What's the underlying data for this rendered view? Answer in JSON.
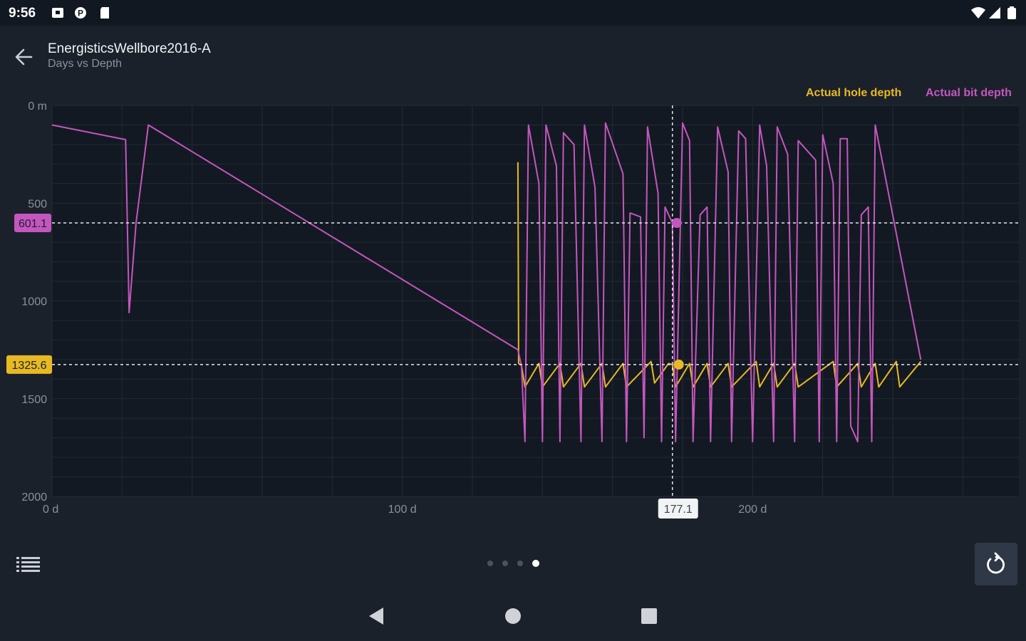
{
  "status_bar": {
    "time": "9:56",
    "left_icons": [
      "notification-square-icon",
      "p-circle-icon",
      "sd-card-icon"
    ],
    "right_icons": [
      "wifi-icon",
      "cell-signal-icon",
      "battery-icon"
    ]
  },
  "app_bar": {
    "title": "EnergisticsWellbore2016-A",
    "subtitle": "Days vs Depth",
    "back_icon": "arrow-left-icon"
  },
  "legend": [
    {
      "name": "Actual hole depth",
      "color": "#e8b923"
    },
    {
      "name": "Actual bit depth",
      "color": "#c456bf"
    }
  ],
  "chart_data": {
    "type": "line",
    "xlabel": "",
    "ylabel": "",
    "x_unit": "d",
    "y_unit": "m",
    "xlim": [
      0,
      276
    ],
    "ylim": [
      2000,
      0
    ],
    "y_reversed": true,
    "x_ticks": [
      "0 d",
      "100 d",
      "200 d"
    ],
    "x_tick_values": [
      0,
      100,
      200
    ],
    "y_ticks": [
      "0 m",
      "500",
      "1000",
      "1500",
      "2000"
    ],
    "y_tick_values": [
      0,
      500,
      1000,
      1500,
      2000
    ],
    "grid": true,
    "legend_position": "top-right",
    "cursor": {
      "x": 177.1,
      "x_label": "177.1",
      "bit_depth_label": "601.1",
      "bit_depth": 601.1,
      "hole_depth_label": "1325.6",
      "hole_depth": 1325.6
    },
    "series": [
      {
        "name": "Actual hole depth",
        "color": "#e8b923",
        "points": [
          [
            133.0,
            290
          ],
          [
            133.2,
            1320
          ],
          [
            134,
            1330
          ],
          [
            135,
            1440
          ],
          [
            139,
            1320
          ],
          [
            140,
            1440
          ],
          [
            145,
            1320
          ],
          [
            146,
            1440
          ],
          [
            151,
            1320
          ],
          [
            152,
            1440
          ],
          [
            157,
            1320
          ],
          [
            158,
            1440
          ],
          [
            163,
            1320
          ],
          [
            164,
            1440
          ],
          [
            171,
            1310
          ],
          [
            172,
            1420
          ],
          [
            176,
            1320
          ],
          [
            177.1,
            1325.6
          ],
          [
            178,
            1440
          ],
          [
            182,
            1320
          ],
          [
            183,
            1440
          ],
          [
            187,
            1320
          ],
          [
            188,
            1440
          ],
          [
            193,
            1320
          ],
          [
            194,
            1440
          ],
          [
            201,
            1310
          ],
          [
            202,
            1440
          ],
          [
            206,
            1320
          ],
          [
            207,
            1440
          ],
          [
            212,
            1320
          ],
          [
            213,
            1440
          ],
          [
            223,
            1310
          ],
          [
            224,
            1440
          ],
          [
            230,
            1320
          ],
          [
            231,
            1440
          ],
          [
            235,
            1320
          ],
          [
            236,
            1440
          ],
          [
            241,
            1310
          ],
          [
            242,
            1440
          ],
          [
            248,
            1310
          ]
        ]
      },
      {
        "name": "Actual bit depth",
        "color": "#c456bf",
        "points": [
          [
            0,
            100
          ],
          [
            21,
            175
          ],
          [
            21.5,
            600
          ],
          [
            22,
            1060
          ],
          [
            24,
            600
          ],
          [
            27.5,
            100
          ],
          [
            133,
            1250
          ],
          [
            134,
            1330
          ],
          [
            135,
            1720
          ],
          [
            136,
            100
          ],
          [
            139,
            400
          ],
          [
            140,
            1720
          ],
          [
            141,
            100
          ],
          [
            144,
            310
          ],
          [
            145,
            1720
          ],
          [
            146,
            140
          ],
          [
            149,
            200
          ],
          [
            151,
            1720
          ],
          [
            152,
            100
          ],
          [
            155,
            420
          ],
          [
            157,
            1720
          ],
          [
            158,
            90
          ],
          [
            163,
            350
          ],
          [
            164,
            1720
          ],
          [
            165,
            550
          ],
          [
            168,
            570
          ],
          [
            169,
            1700
          ],
          [
            170,
            110
          ],
          [
            173,
            450
          ],
          [
            174,
            1720
          ],
          [
            175,
            520
          ],
          [
            177.1,
            601.1
          ],
          [
            178,
            1720
          ],
          [
            180,
            90
          ],
          [
            182,
            180
          ],
          [
            183,
            1720
          ],
          [
            185,
            560
          ],
          [
            187,
            520
          ],
          [
            188,
            1720
          ],
          [
            190,
            110
          ],
          [
            193,
            340
          ],
          [
            194,
            1720
          ],
          [
            196,
            130
          ],
          [
            198,
            170
          ],
          [
            200,
            1720
          ],
          [
            202,
            100
          ],
          [
            204,
            310
          ],
          [
            206,
            1720
          ],
          [
            207,
            110
          ],
          [
            210,
            250
          ],
          [
            212,
            1720
          ],
          [
            213,
            180
          ],
          [
            218,
            280
          ],
          [
            219,
            1720
          ],
          [
            220,
            150
          ],
          [
            223,
            400
          ],
          [
            224,
            1720
          ],
          [
            225,
            170
          ],
          [
            227,
            170
          ],
          [
            228,
            1640
          ],
          [
            230,
            1720
          ],
          [
            231,
            560
          ],
          [
            233,
            520
          ],
          [
            234,
            1720
          ],
          [
            235,
            100
          ],
          [
            248,
            1300
          ]
        ]
      }
    ]
  },
  "bottom_bar": {
    "list_icon": "list-icon",
    "page_count": 4,
    "active_page": 3,
    "reset_icon": "reset-zoom-icon"
  },
  "nav_bar": {
    "icons": [
      "nav-back-icon",
      "nav-home-icon",
      "nav-recents-icon"
    ]
  },
  "colors": {
    "background": "#1a212b",
    "plot_background": "#131922",
    "grid": "#222a35",
    "hole_depth": "#e8b923",
    "bit_depth": "#c456bf",
    "axis_text": "#8a919b"
  }
}
